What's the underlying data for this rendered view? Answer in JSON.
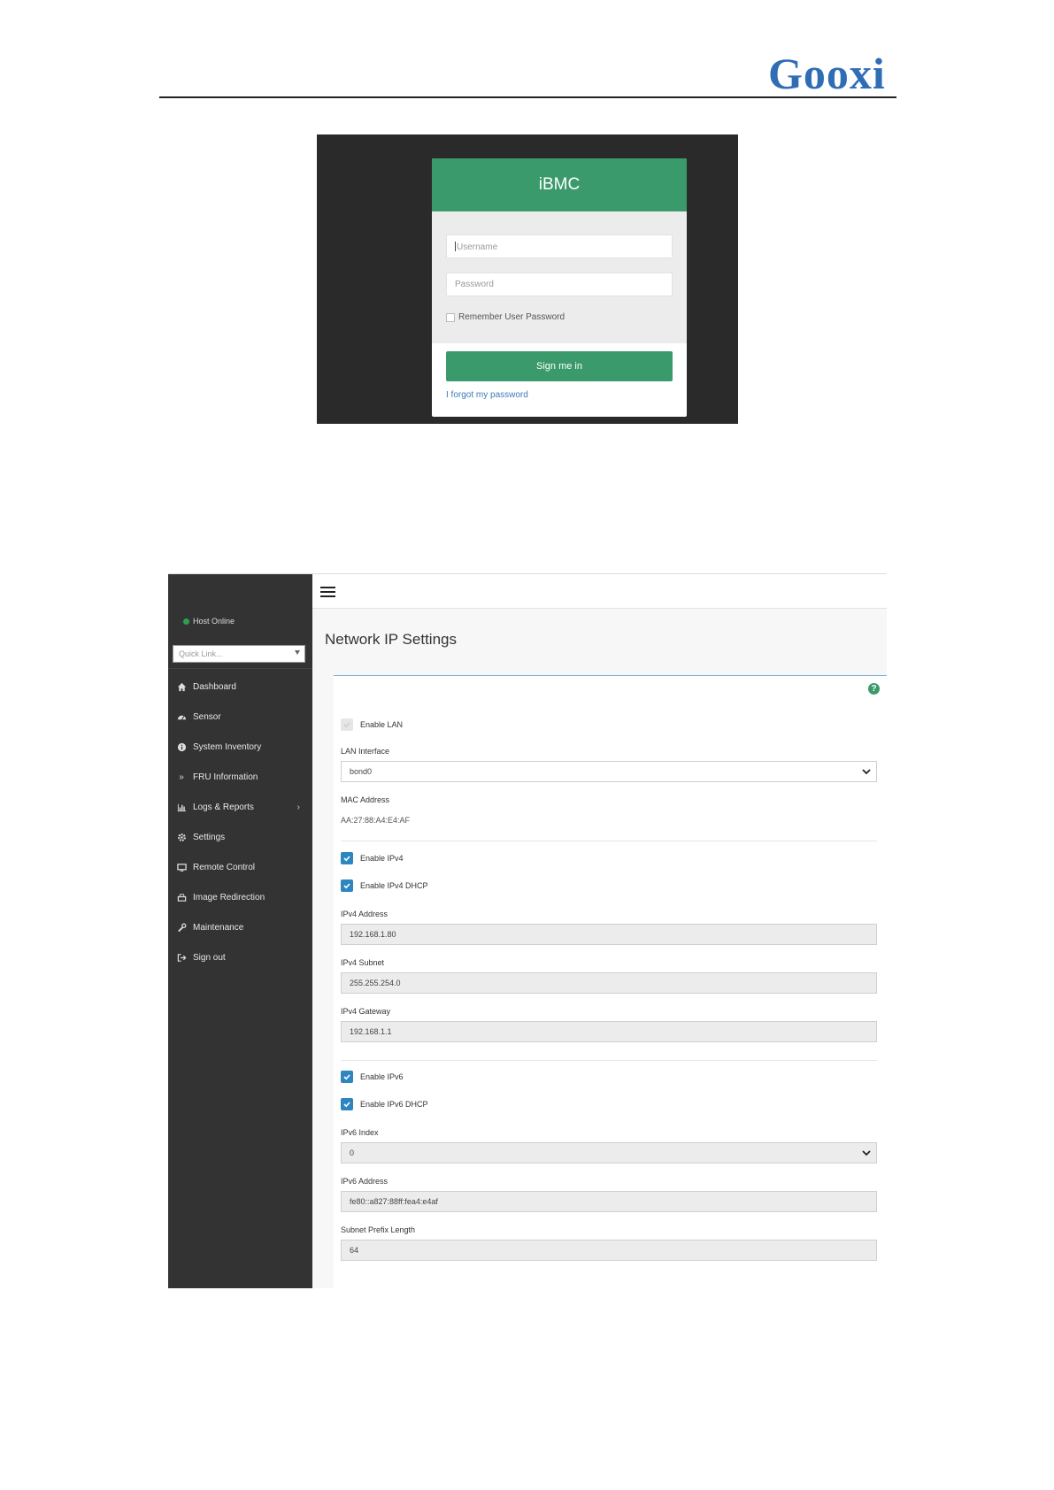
{
  "header": {
    "logo_text": "Gooxi"
  },
  "login": {
    "title": "iBMC",
    "username_placeholder": "Username",
    "password_placeholder": "Password",
    "remember_label": "Remember User Password",
    "signin_label": "Sign me in",
    "forgot_label": "I forgot my password",
    "accent_color": "#3b9a6b"
  },
  "sidebar": {
    "status": "Host Online",
    "quick_link_placeholder": "Quick Link...",
    "items": [
      {
        "label": "Dashboard",
        "icon": "home-icon"
      },
      {
        "label": "Sensor",
        "icon": "gauge-icon"
      },
      {
        "label": "System Inventory",
        "icon": "info-icon"
      },
      {
        "label": "FRU Information",
        "icon": "double-chevron-icon"
      },
      {
        "label": "Logs & Reports",
        "icon": "bar-chart-icon"
      },
      {
        "label": "Settings",
        "icon": "gear-icon"
      },
      {
        "label": "Remote Control",
        "icon": "monitor-icon"
      },
      {
        "label": "Image Redirection",
        "icon": "drive-icon"
      },
      {
        "label": "Maintenance",
        "icon": "wrench-icon"
      },
      {
        "label": "Sign out",
        "icon": "sign-out-icon"
      }
    ]
  },
  "main": {
    "page_title": "Network IP Settings",
    "enable_lan": "Enable LAN",
    "lan_interface_label": "LAN Interface",
    "lan_interface_value": "bond0",
    "mac_label": "MAC Address",
    "mac_value": "AA:27:88:A4:E4:AF",
    "enable_ipv4": "Enable IPv4",
    "enable_ipv4_dhcp": "Enable IPv4 DHCP",
    "ipv4_address_label": "IPv4 Address",
    "ipv4_address_value": "192.168.1.80",
    "ipv4_subnet_label": "IPv4 Subnet",
    "ipv4_subnet_value": "255.255.254.0",
    "ipv4_gateway_label": "IPv4 Gateway",
    "ipv4_gateway_value": "192.168.1.1",
    "enable_ipv6": "Enable IPv6",
    "enable_ipv6_dhcp": "Enable IPv6 DHCP",
    "ipv6_index_label": "IPv6 Index",
    "ipv6_index_value": "0",
    "ipv6_address_label": "IPv6 Address",
    "ipv6_address_value": "fe80::a827:88ff:fea4:e4af",
    "prefix_label": "Subnet Prefix Length",
    "prefix_value": "64"
  }
}
